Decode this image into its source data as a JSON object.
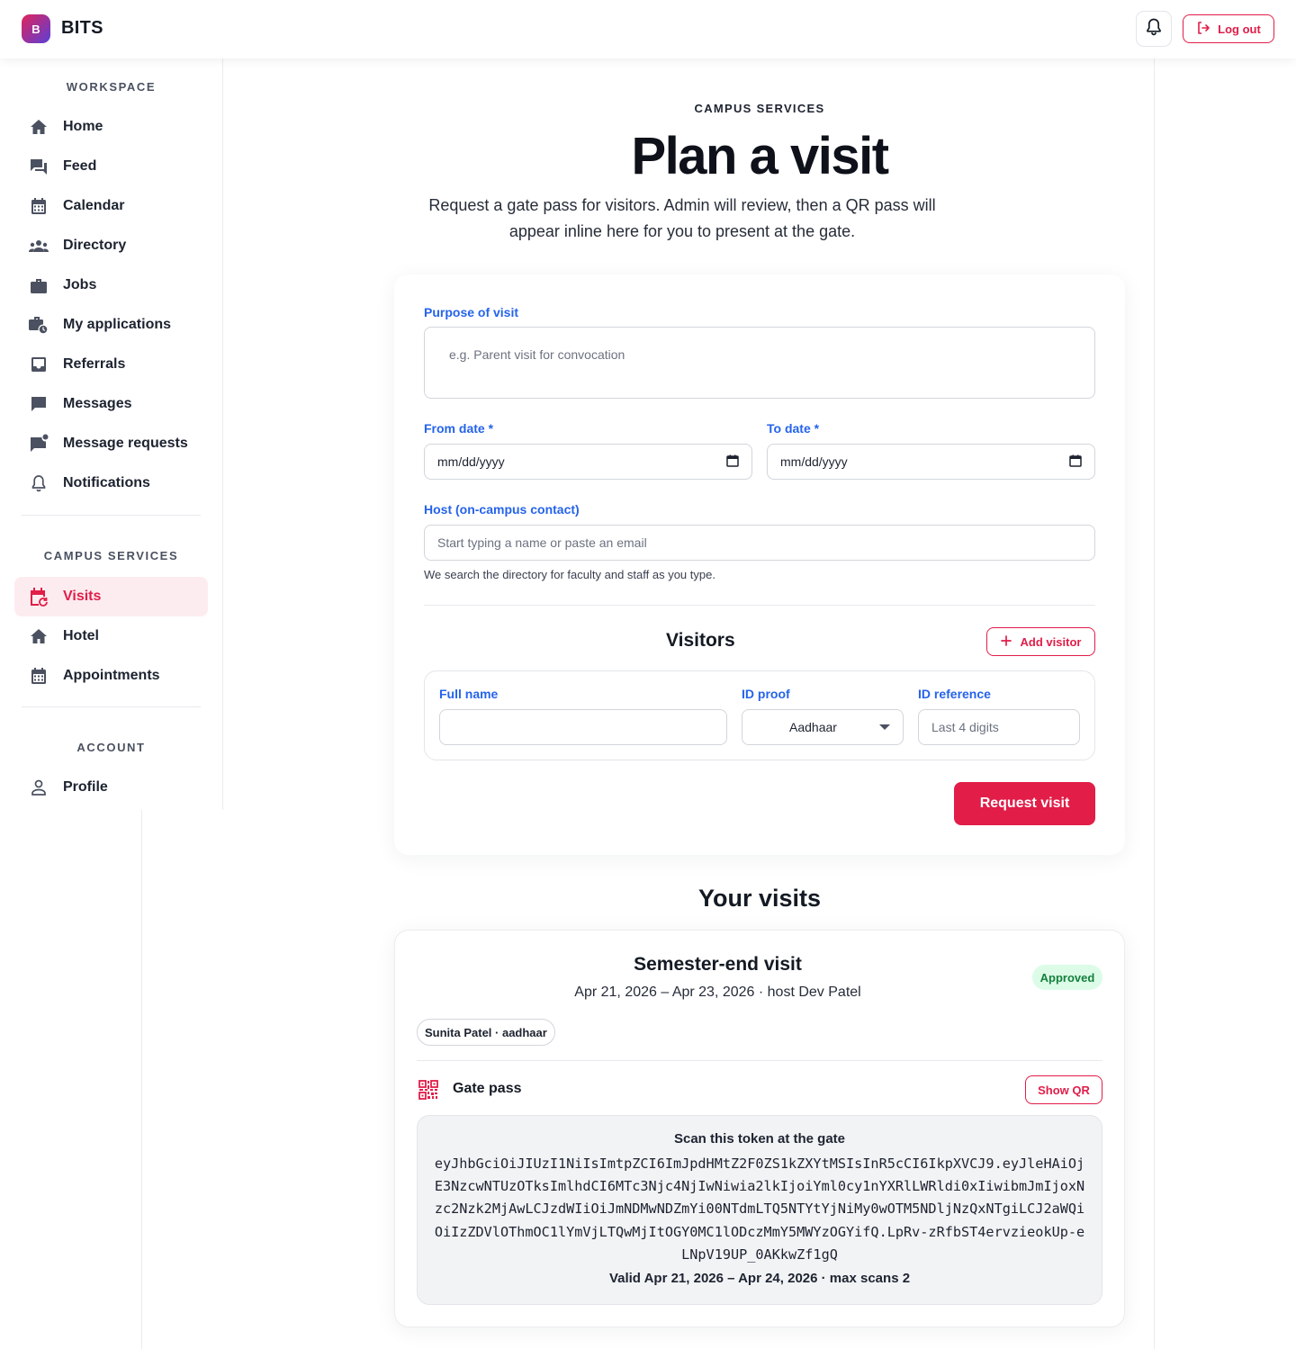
{
  "topbar": {
    "logo_letter": "B",
    "brand": "BITS",
    "logout_label": "Log out"
  },
  "sidebar": {
    "sections": {
      "workspace": "WORKSPACE",
      "campus_services": "CAMPUS SERVICES",
      "account": "ACCOUNT"
    },
    "workspace_items": [
      {
        "label": "Home",
        "icon": "home-icon"
      },
      {
        "label": "Feed",
        "icon": "forum-icon"
      },
      {
        "label": "Calendar",
        "icon": "calendar-icon"
      },
      {
        "label": "Directory",
        "icon": "groups-icon"
      },
      {
        "label": "Jobs",
        "icon": "briefcase-icon"
      },
      {
        "label": "My applications",
        "icon": "work-history-icon"
      },
      {
        "label": "Referrals",
        "icon": "inbox-icon"
      },
      {
        "label": "Messages",
        "icon": "chat-icon"
      },
      {
        "label": "Message requests",
        "icon": "mark-chat-unread-icon"
      },
      {
        "label": "Notifications",
        "icon": "bell-icon"
      }
    ],
    "campus_items": [
      {
        "label": "Visits",
        "icon": "event-repeat-icon",
        "active": true
      },
      {
        "label": "Hotel",
        "icon": "home-icon"
      },
      {
        "label": "Appointments",
        "icon": "calendar-icon"
      }
    ],
    "account_items": [
      {
        "label": "Profile",
        "icon": "person-icon"
      }
    ]
  },
  "header": {
    "eyebrow": "CAMPUS SERVICES",
    "title": "Plan a visit",
    "subtitle": "Request a gate pass for visitors. Admin will review, then a QR pass will appear inline here for you to present at the gate."
  },
  "form": {
    "purpose_label": "Purpose of visit",
    "purpose_placeholder": "e.g. Parent visit for convocation",
    "from_label": "From date *",
    "from_value": "mm/dd/yyyy",
    "to_label": "To date *",
    "to_value": "mm/dd/yyyy",
    "host_label": "Host (on-campus contact)",
    "host_placeholder": "Start typing a name or paste an email",
    "host_hint": "We search the directory for faculty and staff as you type.",
    "visitors_title": "Visitors",
    "add_visitor_label": "Add visitor",
    "visitor": {
      "full_name_label": "Full name",
      "full_name_value": "",
      "id_proof_label": "ID proof",
      "id_proof_value": "Aadhaar",
      "id_ref_label": "ID reference",
      "id_ref_placeholder": "Last 4 digits"
    },
    "submit_label": "Request visit"
  },
  "visits": {
    "title": "Your visits",
    "items": [
      {
        "title": "Semester-end visit",
        "meta": "Apr 21, 2026 – Apr 23, 2026 · host Dev Patel",
        "status": "Approved",
        "visitor_chip": "Sunita Patel · aadhaar",
        "gate_pass_label": "Gate pass",
        "show_qr_label": "Show QR",
        "token_heading": "Scan this token at the gate",
        "token": "eyJhbGciOiJIUzI1NiIsImtpZCI6ImJpdHMtZ2F0ZS1kZXYtMSIsInR5cCI6IkpXVCJ9.eyJleHAiOjE3NzcwNTUzOTksImlhdCI6MTc3Njc4NjIwNiwia2lkIjoiYml0cy1nYXRlLWRldi0xIiwibmJmIjoxNzc2Nzk2MjAwLCJzdWIiOiJmNDMwNDZmYi00NTdmLTQ5NTYtYjNiMy0wOTM5NDljNzQxNTgiLCJ2aWQiOiIzZDVlOThmOC1lYmVjLTQwMjItOGY0MC1lODczMmY5MWYzOGYifQ.LpRv-zRfbST4ervzieokUp-eLNpV19UP_0AKkwZf1gQ",
        "validity": "Valid Apr 21, 2026 – Apr 24, 2026 · max scans 2"
      }
    ]
  },
  "colors": {
    "accent": "#e11d48",
    "label_blue": "#2563eb",
    "approved_bg": "#dcfce7",
    "approved_text": "#15803d"
  }
}
